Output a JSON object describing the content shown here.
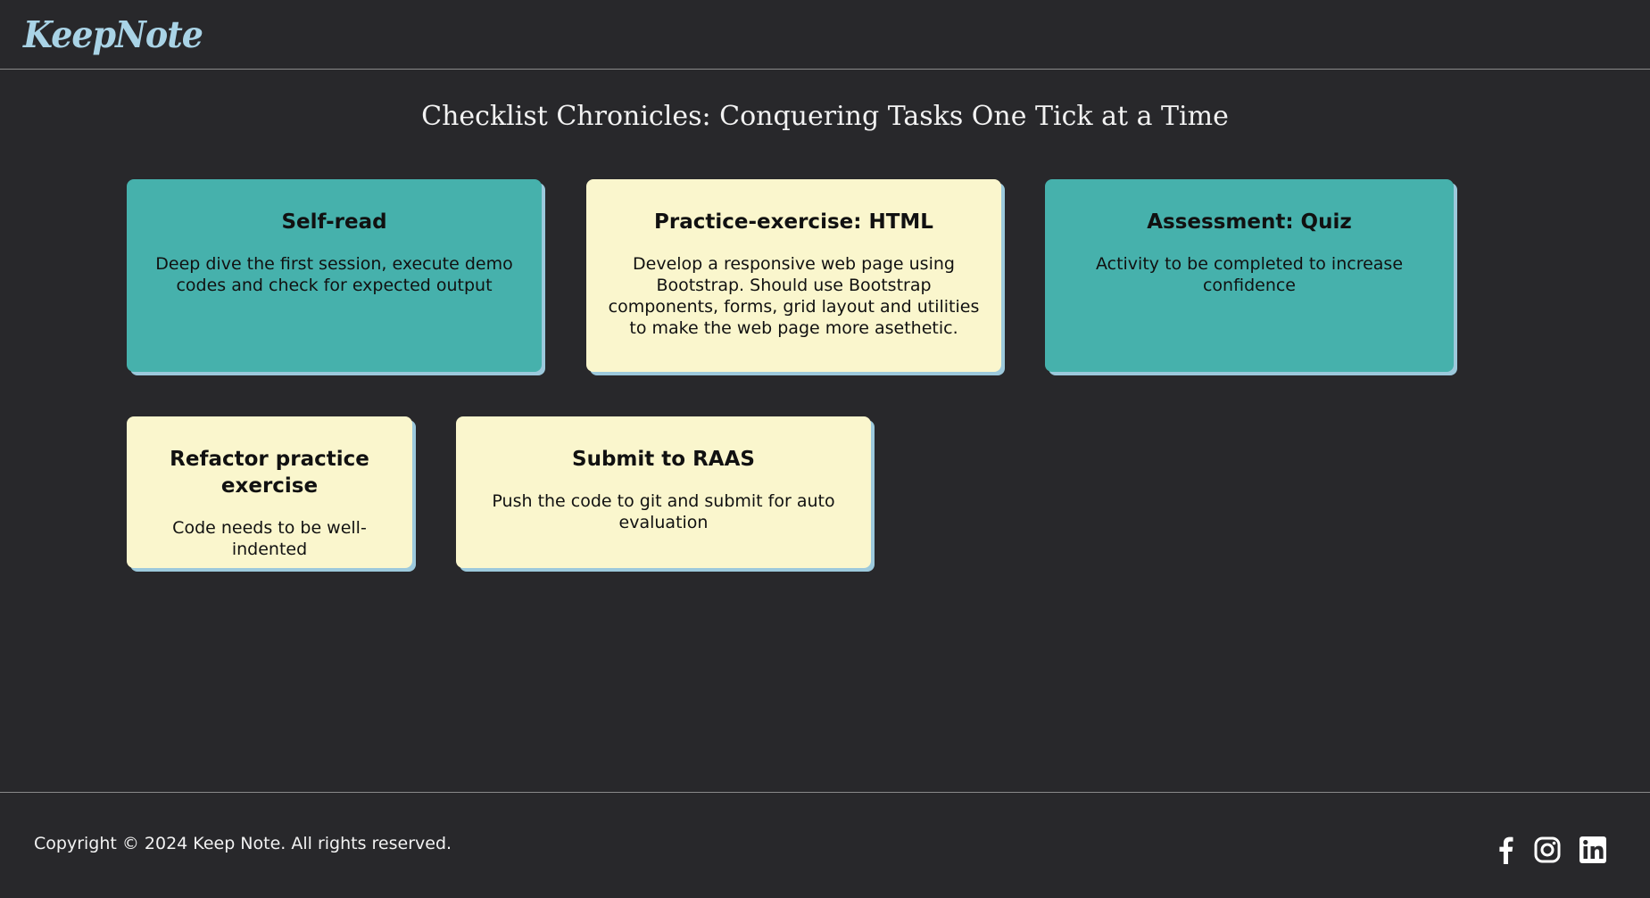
{
  "header": {
    "logo_text": "KeepNote"
  },
  "main": {
    "title": "Checklist Chronicles: Conquering Tasks One Tick at a Time",
    "cards": [
      {
        "title": "Self-read",
        "description": "Deep dive the first session, execute demo codes and check for expected output",
        "color": "#46b1ac"
      },
      {
        "title": "Practice-exercise: HTML",
        "description": "Develop a responsive web page using Bootstrap. Should use Bootstrap components, forms, grid layout and utilities to make the web page more asethetic.",
        "color": "#faf6cd"
      },
      {
        "title": "Assessment: Quiz",
        "description": "Activity to be completed to increase confidence",
        "color": "#46b1ac"
      },
      {
        "title": "Refactor practice exercise",
        "description": "Code needs to be well-indented",
        "color": "#faf6cd"
      },
      {
        "title": "Submit to RAAS",
        "description": "Push the code to git and submit for auto evaluation",
        "color": "#faf6cd"
      }
    ]
  },
  "footer": {
    "copyright": "Copyright © 2024 Keep Note. All rights reserved.",
    "social_icons": [
      "facebook-icon",
      "instagram-icon",
      "linkedin-icon"
    ]
  },
  "colors": {
    "background": "#28282b",
    "teal_card": "#46b1ac",
    "cream_card": "#faf6cd",
    "card_shadow": "#9cc9dc",
    "logo": "#a9d3e6"
  }
}
